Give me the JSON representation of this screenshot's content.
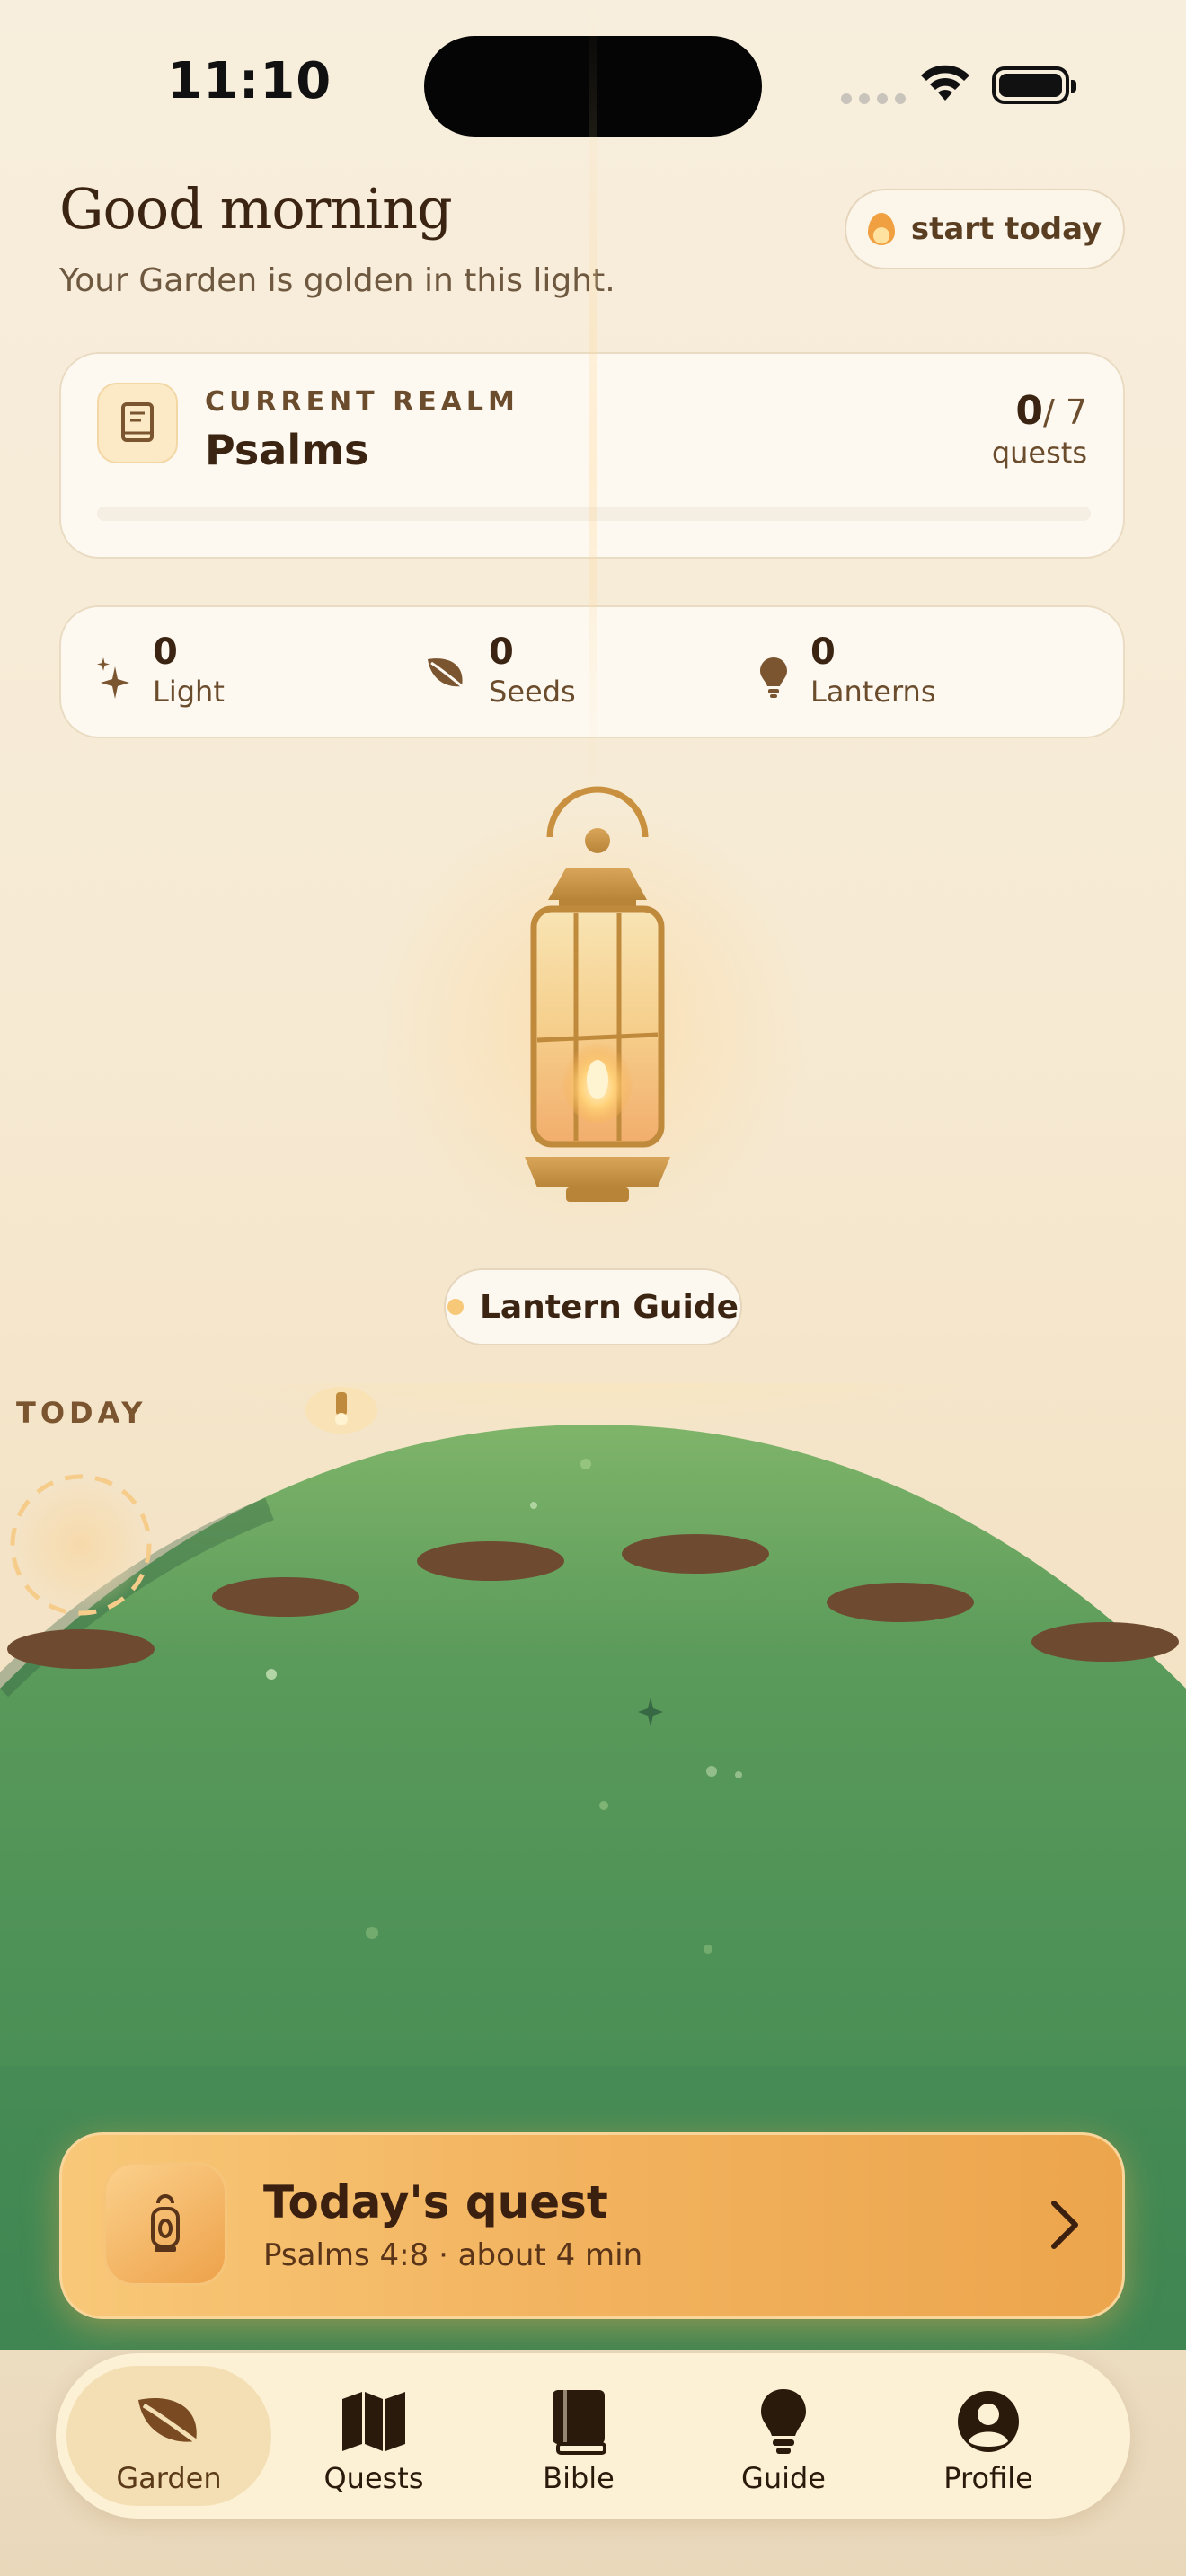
{
  "status_bar": {
    "time": "11:10"
  },
  "header": {
    "greeting": "Good morning",
    "subtitle": "Your Garden is golden in this light.",
    "start_button": "start today"
  },
  "realm": {
    "kicker": "CURRENT REALM",
    "name": "Psalms",
    "quests_done": "0",
    "quests_total": "/ 7",
    "quests_unit": "quests",
    "progress": 0
  },
  "stats": [
    {
      "value": "0",
      "label": "Light",
      "icon": "sparkle-icon"
    },
    {
      "value": "0",
      "label": "Seeds",
      "icon": "leaf-icon"
    },
    {
      "value": "0",
      "label": "Lanterns",
      "icon": "bulb-icon"
    }
  ],
  "lantern_guide": {
    "label": "Lantern Guide"
  },
  "garden": {
    "today_label": "TODAY"
  },
  "quest_banner": {
    "title": "Today's quest",
    "subtitle": "Psalms 4:8 · about 4 min"
  },
  "tabs": [
    {
      "label": "Garden",
      "icon": "leaf-icon",
      "active": true
    },
    {
      "label": "Quests",
      "icon": "map-icon",
      "active": false
    },
    {
      "label": "Bible",
      "icon": "book-icon",
      "active": false
    },
    {
      "label": "Guide",
      "icon": "bulb-icon",
      "active": false
    },
    {
      "label": "Profile",
      "icon": "person-icon",
      "active": false
    }
  ],
  "colors": {
    "background": "#f6ead3",
    "accent": "#eca54c",
    "text": "#3b2512",
    "hill": "#4f8f55"
  }
}
